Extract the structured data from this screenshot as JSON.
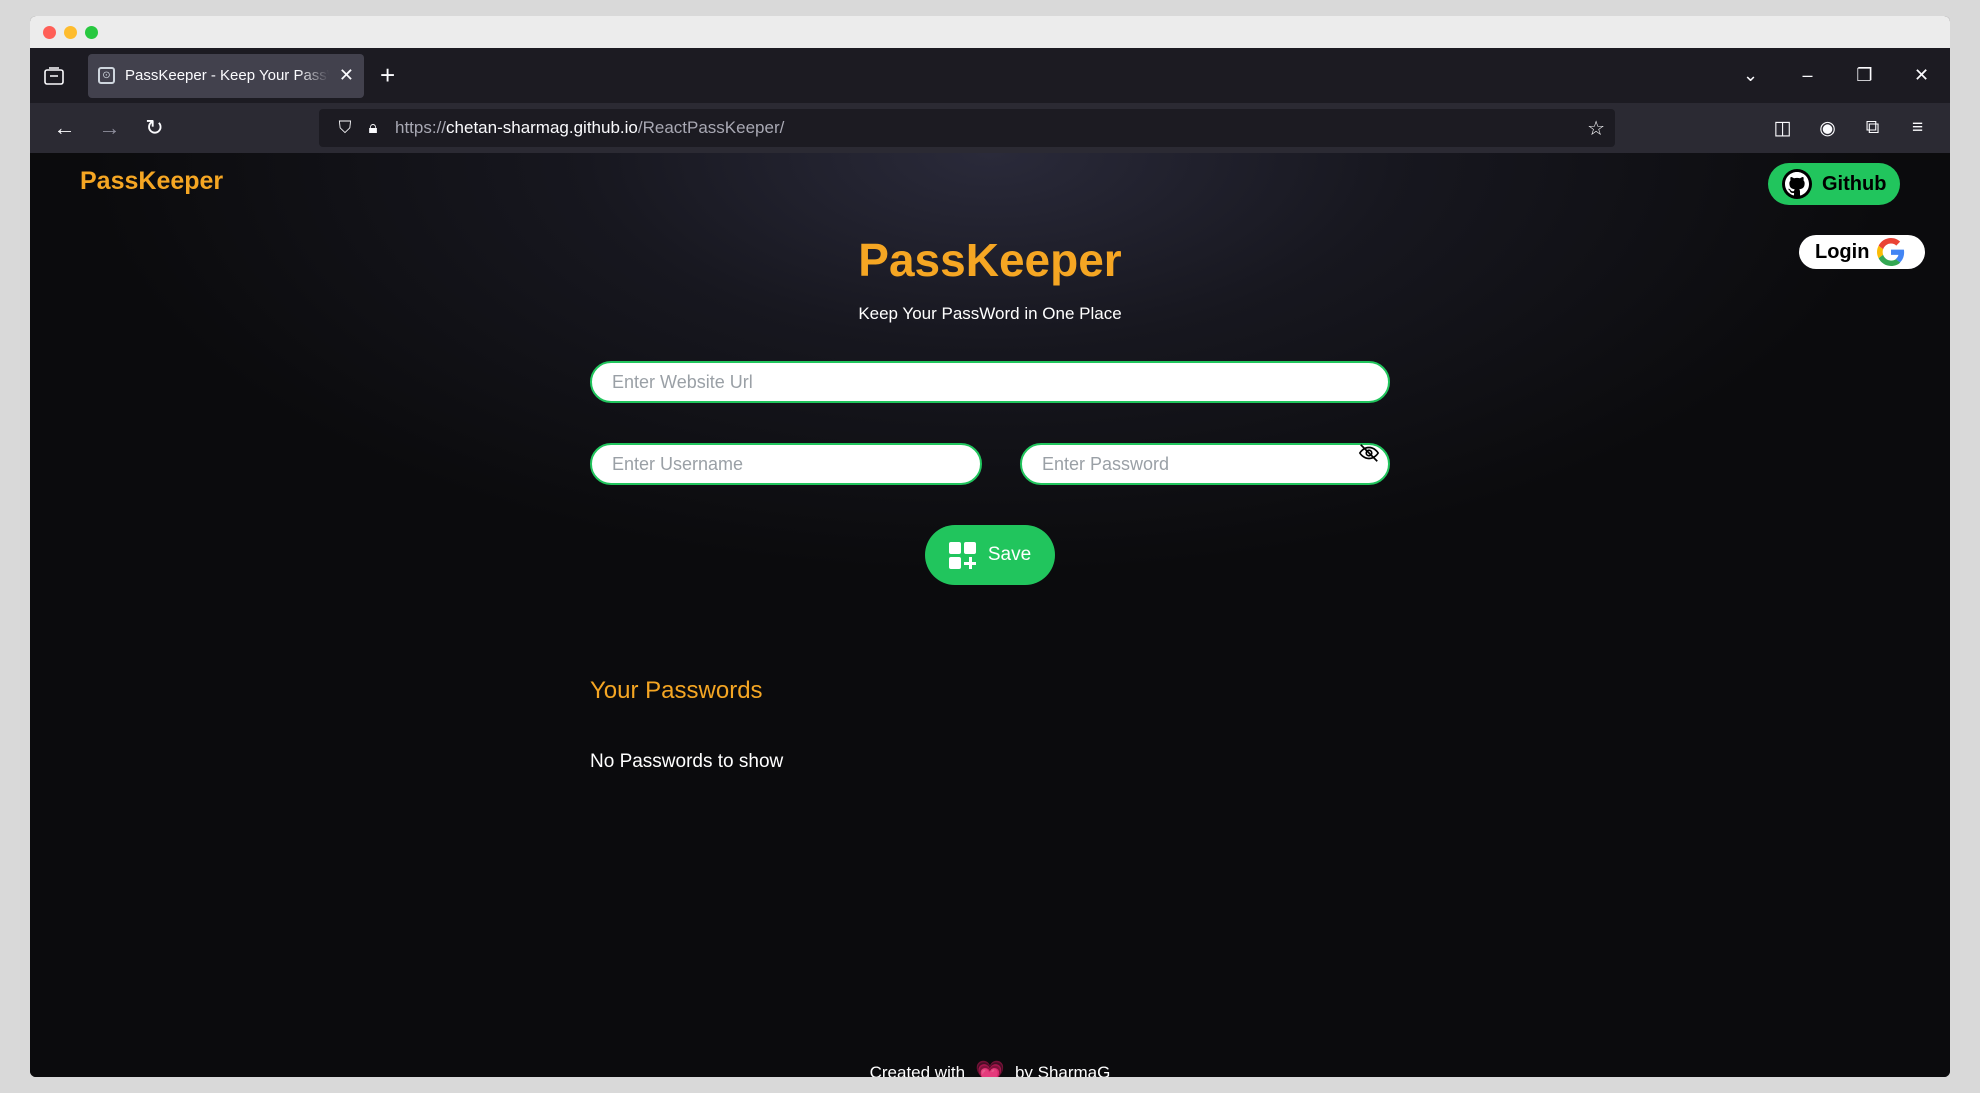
{
  "browser": {
    "tab_title": "PassKeeper - Keep Your PassWord in One Place",
    "new_tab": "+",
    "tab_close": "✕",
    "url_scheme": "https://",
    "url_host": "chetan-sharmag.github.io",
    "url_path": "/ReactPassKeeper/"
  },
  "header": {
    "brand_pass": "Pass",
    "brand_keeper": "Keeper",
    "github_label": "Github",
    "login_label": "Login"
  },
  "hero": {
    "title_pass": "Pass",
    "title_keeper": "Keeper",
    "subtitle": "Keep Your PassWord in One Place"
  },
  "form": {
    "website_placeholder": "Enter Website Url",
    "username_placeholder": "Enter Username",
    "password_placeholder": "Enter Password",
    "save_label": "Save"
  },
  "passwords": {
    "title": "Your Passwords",
    "empty_text": "No Passwords to show"
  },
  "footer": {
    "prefix": "Created with",
    "suffix": "by SharmaG"
  },
  "colors": {
    "accent": "#f5a623",
    "green": "#21c55d"
  }
}
